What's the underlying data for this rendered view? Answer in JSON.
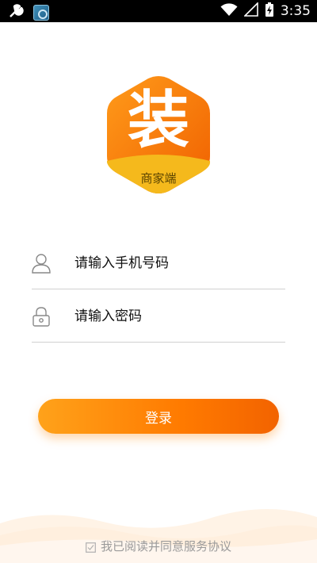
{
  "status_bar": {
    "time": "3:35",
    "left_icons": [
      "wrench-icon",
      "app-notification-icon"
    ],
    "right_icons": [
      "wifi-icon",
      "signal-icon",
      "battery-charging-icon"
    ]
  },
  "logo": {
    "char": "装",
    "subtitle": "商家端",
    "colors": {
      "orange": "#ff8a00",
      "dark_orange": "#f26a00",
      "yellow": "#f5b91c"
    }
  },
  "form": {
    "phone": {
      "placeholder": "请输入手机号码",
      "value": "",
      "icon": "user-icon"
    },
    "password": {
      "placeholder": "请输入密码",
      "value": "",
      "icon": "lock-icon"
    }
  },
  "login_button": {
    "label": "登录",
    "color": "#ff8a00"
  },
  "agreement": {
    "text": "我已阅读并同意服务协议",
    "checked": true
  }
}
